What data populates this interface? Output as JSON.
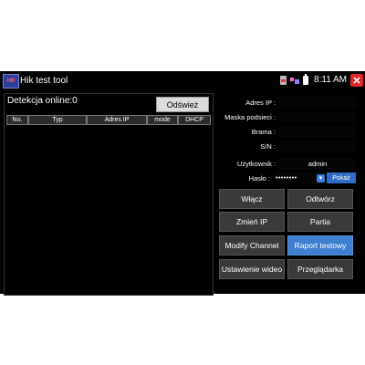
{
  "app": {
    "title": "Hik test tool",
    "icon_label": "HIK"
  },
  "statusbar": {
    "time": "8:11 AM",
    "close_label": "✕"
  },
  "left_panel": {
    "detection_label": "Detekcja online:0",
    "refresh_button": "Odśwież",
    "columns": [
      "No.",
      "Typ",
      "Adres IP",
      "mode",
      "DHCP"
    ]
  },
  "form": {
    "ip_label": "Adres IP :",
    "mask_label": "Maska podsieci :",
    "gateway_label": "Brama :",
    "sn_label": "S/N :",
    "user_label": "Użytkownik :",
    "user_value": "admin",
    "password_label": "Hasło :",
    "password_value": "••••••••",
    "show_button": "Pokaż"
  },
  "buttons": {
    "enable": "Włącz",
    "play": "Odtwórz",
    "change_ip": "Zmień IP",
    "batch": "Partia",
    "modify_channel": "Modify Channel",
    "test_report": "Raport testowy",
    "video_settings": "Ustawienie wideo",
    "browser": "Przeglądarka"
  },
  "colors": {
    "accent": "#3f7fcf",
    "close": "#e0262a",
    "background": "#000000"
  }
}
